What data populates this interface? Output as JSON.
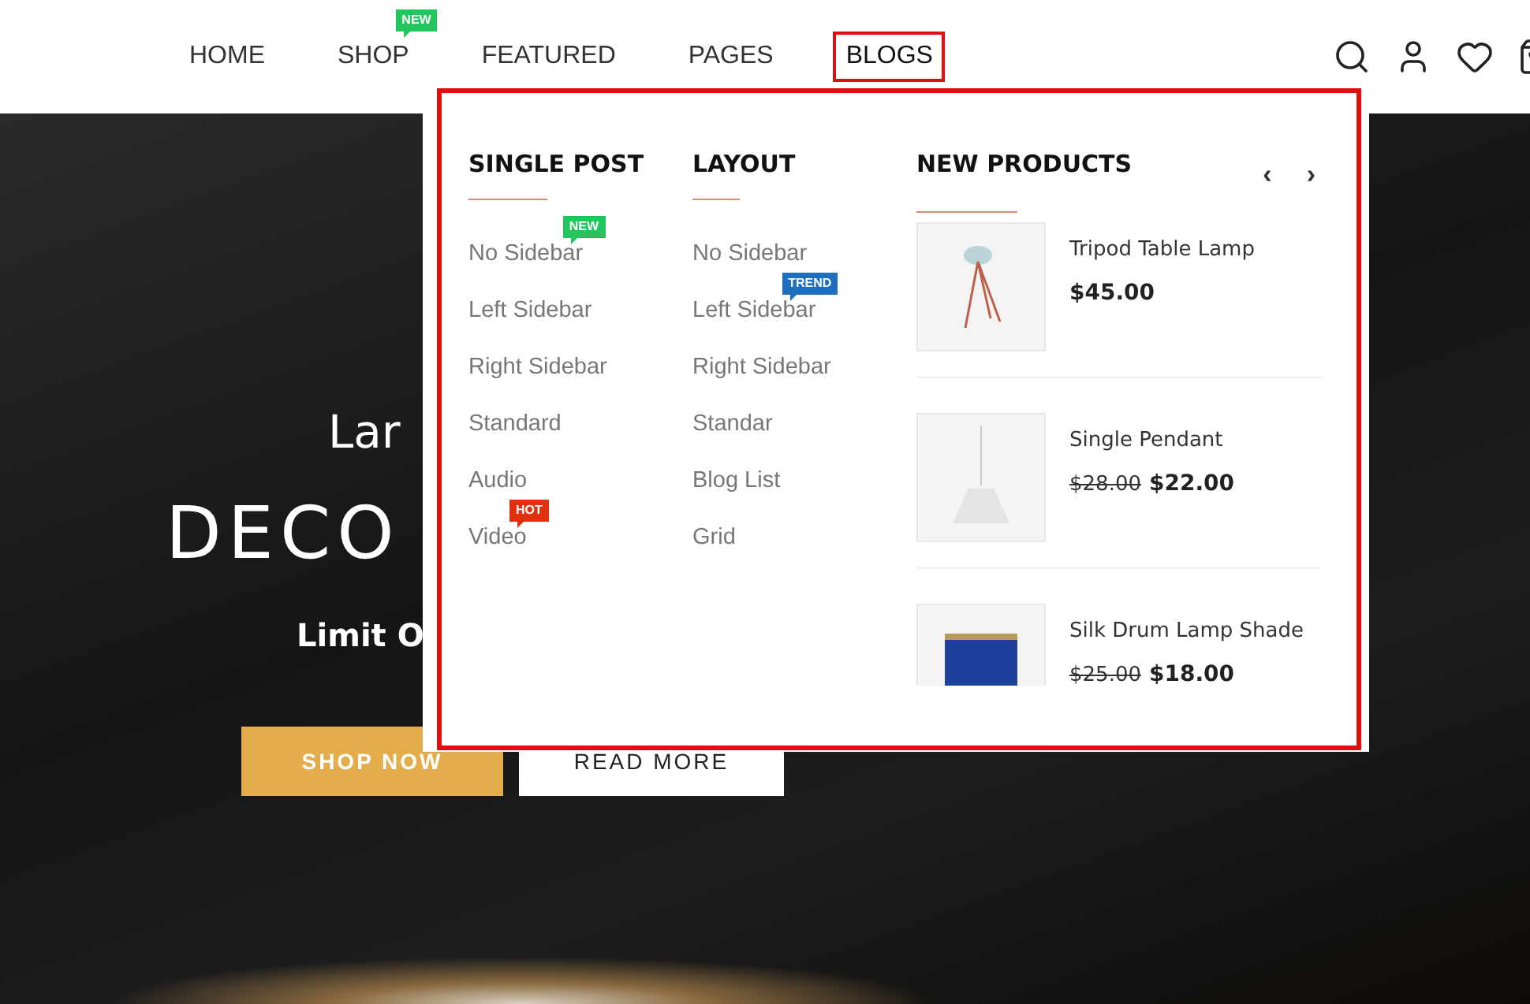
{
  "nav": {
    "items": [
      {
        "label": "HOME",
        "selected": false,
        "highlighted": false
      },
      {
        "label": "SHOP",
        "selected": false,
        "highlighted": false,
        "badge": {
          "text": "NEW",
          "color": "#22c55e"
        }
      },
      {
        "label": "FEATURED",
        "selected": false,
        "highlighted": false
      },
      {
        "label": "PAGES",
        "selected": false,
        "highlighted": false
      },
      {
        "label": "BLOGS",
        "selected": true,
        "highlighted": true
      }
    ]
  },
  "hero": {
    "eyebrow": "Lar",
    "title": "DECO",
    "subtitle": "Limit O",
    "buttons": [
      {
        "label": "SHOP NOW",
        "kind": "primary"
      },
      {
        "label": "READ MORE",
        "kind": "secondary"
      }
    ]
  },
  "dropdown": {
    "highlighted": true,
    "columns": [
      {
        "title": "SINGLE POST",
        "items": [
          {
            "label": "No Sidebar",
            "badge": {
              "text": "NEW",
              "color": "#22c55e"
            }
          },
          {
            "label": "Left Sidebar"
          },
          {
            "label": "Right Sidebar"
          },
          {
            "label": "Standard"
          },
          {
            "label": "Audio"
          },
          {
            "label": "Video",
            "badge": {
              "text": "HOT",
              "color": "#e0300f"
            }
          }
        ]
      },
      {
        "title": "LAYOUT",
        "items": [
          {
            "label": "No Sidebar"
          },
          {
            "label": "Left Sidebar",
            "badge": {
              "text": "TREND",
              "color": "#1f6fc0"
            }
          },
          {
            "label": "Right Sidebar"
          },
          {
            "label": "Standar"
          },
          {
            "label": "Blog List"
          },
          {
            "label": "Grid"
          }
        ]
      }
    ],
    "products": {
      "title": "NEW PRODUCTS",
      "prev": "‹",
      "next": "›",
      "items": [
        {
          "name": "Tripod Table Lamp",
          "price": "$45.00",
          "kind": "tripod"
        },
        {
          "name": "Single Pendant",
          "old_price": "$28.00",
          "price": "$22.00",
          "kind": "pendant"
        },
        {
          "name": "Silk Drum Lamp Shade",
          "old_price": "$25.00",
          "price": "$18.00",
          "kind": "drum"
        }
      ]
    }
  }
}
